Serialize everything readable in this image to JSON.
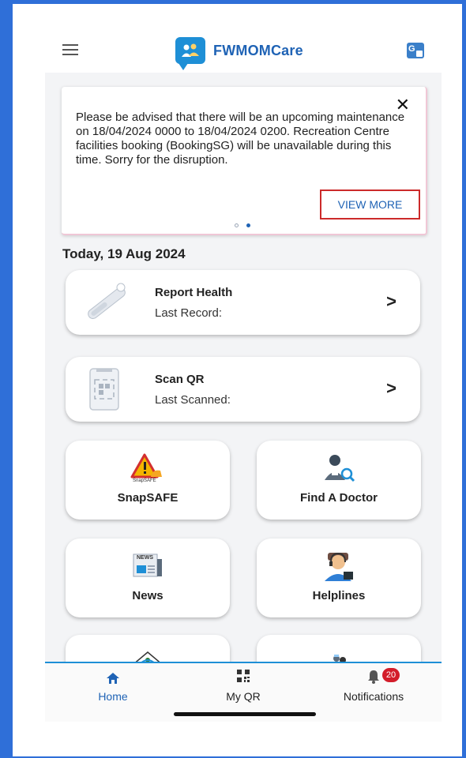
{
  "header": {
    "app_title": "FWMOMCare",
    "menu_icon": "hamburger-menu-icon",
    "translate_icon": "translate-icon"
  },
  "banner": {
    "message": "Please be advised that there will be an upcoming maintenance on 18/04/2024 0000 to 18/04/2024 0200. Recreation Centre facilities booking (BookingSG) will be unavailable during this time. Sorry for the disruption.",
    "button_label": "VIEW MORE",
    "close_icon": "close-icon",
    "pages_total": 2,
    "active_page": 2
  },
  "date_label": "Today, 19 Aug 2024",
  "cards": [
    {
      "title": "Report Health",
      "subtitle": "Last Record:",
      "icon": "thermometer-icon"
    },
    {
      "title": "Scan QR",
      "subtitle": "Last Scanned:",
      "icon": "qr-scanner-icon"
    }
  ],
  "tiles": [
    {
      "label": "SnapSAFE",
      "icon": "snapsafe-warning-icon",
      "icon_text": "SnapSAFE"
    },
    {
      "label": "Find A Doctor",
      "icon": "doctor-search-icon"
    },
    {
      "label": "News",
      "icon": "newspaper-icon",
      "icon_text": "NEWS"
    },
    {
      "label": "Helplines",
      "icon": "helpline-agent-icon"
    },
    {
      "label": "",
      "icon": "recreation-icon"
    },
    {
      "label": "",
      "icon": "people-icon"
    }
  ],
  "bottom_nav": [
    {
      "label": "Home",
      "icon": "home-icon",
      "active": true
    },
    {
      "label": "My QR",
      "icon": "qr-code-icon",
      "active": false
    },
    {
      "label": "Notifications",
      "icon": "bell-icon",
      "active": false,
      "badge": "20"
    }
  ],
  "colors": {
    "frame": "#2f6fd8",
    "brand_blue": "#1f63b5",
    "accent_blue": "#1e8fd6",
    "highlight_red": "#cc2a2a",
    "badge_red": "#d31d2a",
    "content_bg": "#f3f4f6"
  }
}
